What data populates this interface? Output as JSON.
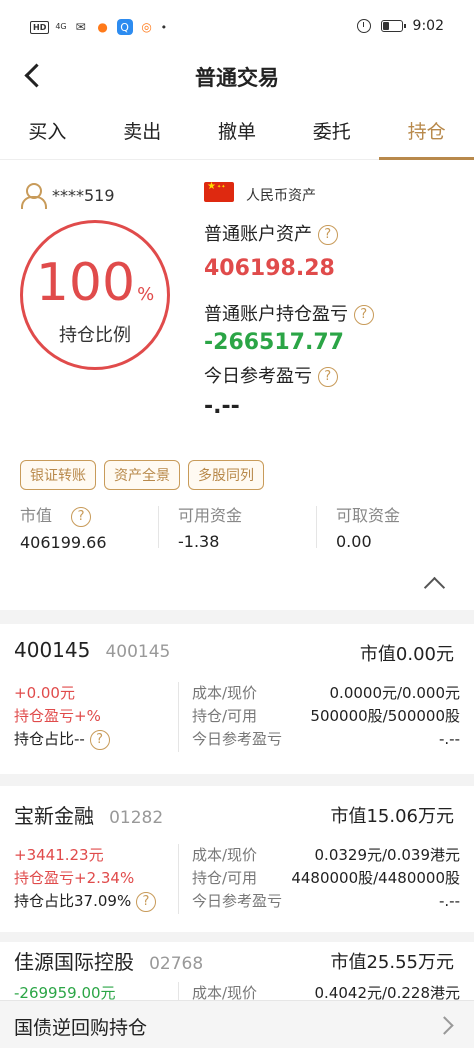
{
  "status_bar": {
    "hd": "HD",
    "signal": "4G",
    "time": "9:02"
  },
  "nav": {
    "title": "普通交易"
  },
  "tabs": [
    {
      "label": "买入"
    },
    {
      "label": "卖出"
    },
    {
      "label": "撤单"
    },
    {
      "label": "委托"
    },
    {
      "label": "持仓",
      "active": true
    }
  ],
  "summary": {
    "account": "****519",
    "position_ratio": "100",
    "position_ratio_unit": "%",
    "position_ratio_label": "持仓比例",
    "asset_type": "人民币资产",
    "total_assets_label": "普通账户资产",
    "total_assets": "406198.28",
    "pnl_label": "普通账户持仓盈亏",
    "pnl": "-266517.77",
    "today_pnl_label": "今日参考盈亏",
    "today_pnl": "-.--",
    "help_glyph": "?",
    "buttons": [
      "银证转账",
      "资产全景",
      "多股同列"
    ],
    "stats": [
      {
        "label": "市值",
        "value": "406199.66",
        "help": true
      },
      {
        "label": "可用资金",
        "value": "-1.38"
      },
      {
        "label": "可取资金",
        "value": "0.00"
      }
    ]
  },
  "holdings": [
    {
      "name": "400145",
      "code": "400145",
      "market_value": "市值0.00元",
      "pnl": "+0.00元",
      "pnl_pct": "持仓盈亏+%",
      "ratio": "持仓占比--",
      "cost_label": "成本/现价",
      "cost": "0.0000元/0.000元",
      "hold_label": "持仓/可用",
      "hold": "500000股/500000股",
      "today_label": "今日参考盈亏",
      "today": "-.--"
    },
    {
      "name": "宝新金融",
      "code": "01282",
      "market_value": "市值15.06万元",
      "pnl": "+3441.23元",
      "pnl_pct": "持仓盈亏+2.34%",
      "ratio": "持仓占比37.09%",
      "cost_label": "成本/现价",
      "cost": "0.0329元/0.039港元",
      "hold_label": "持仓/可用",
      "hold": "4480000股/4480000股",
      "today_label": "今日参考盈亏",
      "today": "-.--"
    },
    {
      "name": "佳源国际控股",
      "code": "02768",
      "market_value": "市值25.55万元",
      "pnl": "-269959.00元",
      "cost_label": "成本/现价",
      "cost": "0.4042元/0.228港元"
    }
  ],
  "bottom_bar": {
    "label": "国债逆回购持仓"
  },
  "colors": {
    "accent": "#b8894b",
    "up": "#e04b4b",
    "down": "#2ba546"
  }
}
